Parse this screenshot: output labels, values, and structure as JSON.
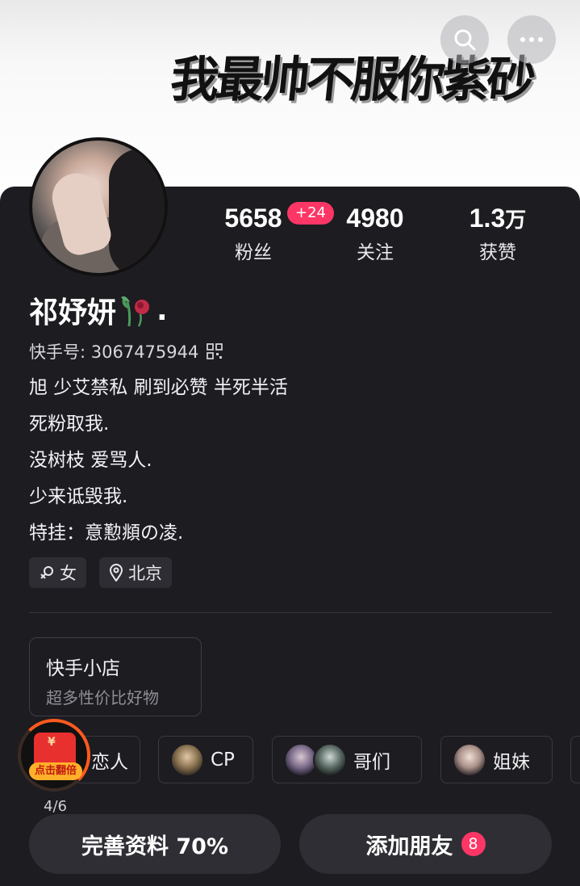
{
  "header": {
    "banner_text": "我最帅不服你紫砂",
    "search_icon": "search-icon",
    "more_icon": "more-icon"
  },
  "profile": {
    "name": "祁妤妍",
    "name_suffix": ".",
    "uid_label": "快手号: 3067475944",
    "bio": [
      "旭 少艾禁私 刷到必赞 半死半活",
      "死粉取我.",
      "没树枝 爱骂人.",
      "少来诋毁我.",
      "特挂：意懃頫の凌."
    ]
  },
  "stats": {
    "fans": {
      "value": "5658",
      "label": "粉丝",
      "badge": "+24"
    },
    "following": {
      "value": "4980",
      "label": "关注"
    },
    "likes": {
      "value": "1.3",
      "unit": "万",
      "label": "获赞"
    }
  },
  "tags": {
    "gender": "女",
    "location": "北京"
  },
  "shop": {
    "title": "快手小店",
    "subtitle": "超多性价比好物"
  },
  "relations": [
    {
      "label": "恋人"
    },
    {
      "label": "CP"
    },
    {
      "label": "哥们"
    },
    {
      "label": "姐妹"
    }
  ],
  "redpacket": {
    "label": "点击翻倍",
    "currency": "¥",
    "progress": "4/6"
  },
  "buttons": {
    "complete_profile": "完善资料 70%",
    "add_friends": "添加朋友",
    "add_friends_count": "8"
  },
  "colors": {
    "accent": "#fe3666",
    "card": "#1d1c21",
    "chip": "#2e2d33"
  }
}
